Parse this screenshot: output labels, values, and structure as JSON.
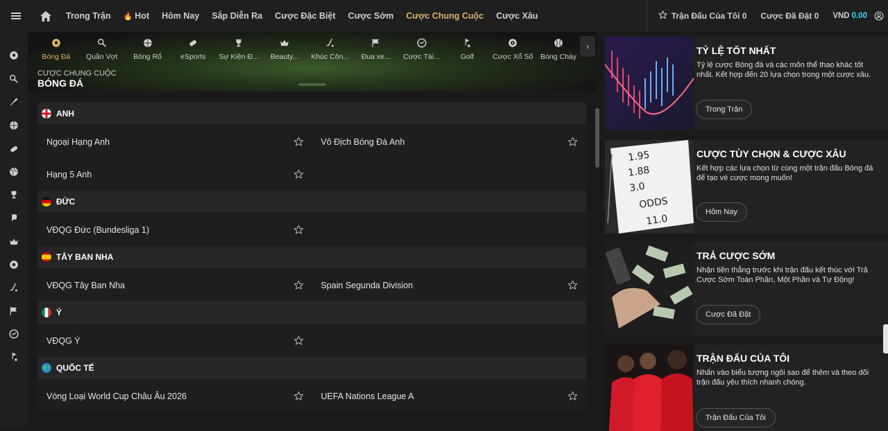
{
  "nav": {
    "items": [
      "Trong Trận",
      "Hot",
      "Hôm Nay",
      "Sắp Diễn Ra",
      "Cược Đặc Biệt",
      "Cược Sớm",
      "Cược Chung Cuộc",
      "Cược Xâu"
    ],
    "active_index": 6
  },
  "topright": {
    "my_matches": "Trận Đấu Của Tôi 0",
    "placed_bets": "Cược Đã Đặt 0",
    "currency": "VND",
    "balance": "0.00"
  },
  "sports": [
    {
      "label": "Bóng Đá",
      "icon": "soccer-ball-icon"
    },
    {
      "label": "Quần Vợt",
      "icon": "tennis-icon"
    },
    {
      "label": "Bóng Rổ",
      "icon": "basketball-icon"
    },
    {
      "label": "eSports",
      "icon": "esports-icon"
    },
    {
      "label": "Sự Kiện Đ...",
      "icon": "trophy-icon"
    },
    {
      "label": "Beauty...",
      "icon": "crown-icon"
    },
    {
      "label": "Khúc Côn...",
      "icon": "hockey-icon"
    },
    {
      "label": "Đua xe...",
      "icon": "racing-flag-icon"
    },
    {
      "label": "Cược Tài...",
      "icon": "finance-icon"
    },
    {
      "label": "Golf",
      "icon": "golf-icon"
    },
    {
      "label": "Cược Xổ Số",
      "icon": "lottery-icon"
    },
    {
      "label": "Bóng Chày",
      "icon": "baseball-icon"
    }
  ],
  "hero": {
    "subtitle": "CƯỢC CHUNG CUỘC",
    "title": "BÓNG ĐÁ"
  },
  "leagues": [
    {
      "country": "ANH",
      "flag": "england",
      "rows": [
        [
          "Ngoại Hạng Anh",
          "Vô Địch Bóng Đá Anh"
        ],
        [
          "Hạng 5 Anh",
          ""
        ]
      ]
    },
    {
      "country": "ĐỨC",
      "flag": "germany",
      "rows": [
        [
          "VĐQG Đức (Bundesliga 1)",
          ""
        ]
      ]
    },
    {
      "country": "TÂY BAN NHA",
      "flag": "spain",
      "rows": [
        [
          "VĐQG Tây Ban Nha",
          "Spain Segunda Division"
        ]
      ]
    },
    {
      "country": "Ý",
      "flag": "italy",
      "rows": [
        [
          "VĐQG Ý",
          ""
        ]
      ]
    },
    {
      "country": "QUỐC TẾ",
      "flag": "international",
      "rows": [
        [
          "Vòng Loại World Cup Châu Âu 2026",
          "UEFA Nations League A"
        ]
      ]
    }
  ],
  "promos": [
    {
      "title": "TỶ LỆ TỐT NHẤT",
      "desc": "Tỷ lệ cược Bóng đá và các môn thể thao khác tốt nhất. Kết hợp đến 20 lựa chọn trong một cược xâu.",
      "button": "Trong Trận"
    },
    {
      "title": "CƯỢC TÙY CHỌN & CƯỢC XÂU",
      "desc": "Kết hợp các lựa chọn từ cùng một trận đấu Bóng đá để tạo vé cược mong muốn!",
      "button": "Hôm Nay"
    },
    {
      "title": "TRẢ CƯỢC SỚM",
      "desc": "Nhận tiền thắng trước khi trận đấu kết thúc với Trả Cược Sớm Toàn Phần, Một Phần và Tự Động!",
      "button": "Cược Đã Đặt"
    },
    {
      "title": "TRẬN ĐẤU CỦA TÔI",
      "desc": "Nhấn vào biểu tượng ngôi sao để thêm và theo dõi trận đấu yêu thích nhanh chóng.",
      "button": "Trận Đấu Của Tôi"
    }
  ],
  "colors": {
    "accent": "#d9b46a",
    "balance": "#3fd0ff"
  }
}
